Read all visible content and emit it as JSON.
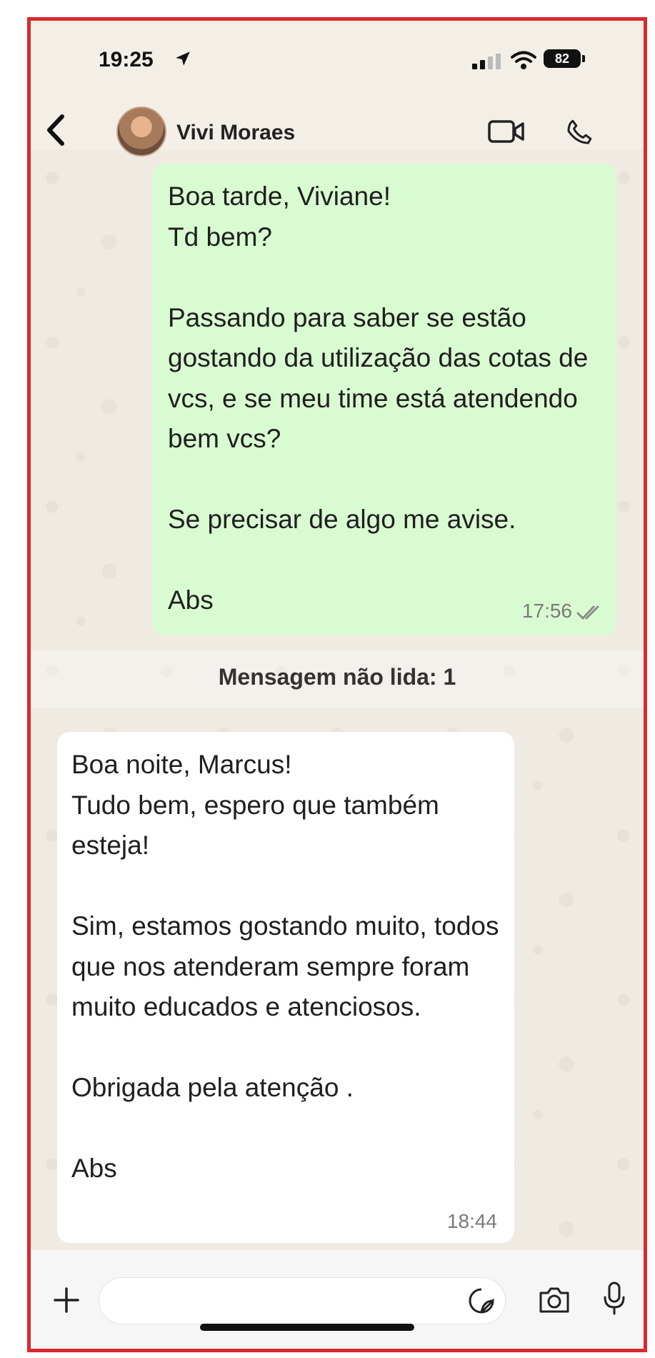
{
  "status_bar": {
    "time": "19:25",
    "battery": "82"
  },
  "header": {
    "contact_name": "Vivi Moraes"
  },
  "messages": [
    {
      "direction": "outgoing",
      "text": "Boa tarde, Viviane!\nTd bem?\n\nPassando para saber se estão gostando da utilização das cotas de vcs, e se meu time está atendendo bem vcs?\n\nSe precisar de algo me avise.\n\nAbs",
      "time": "17:56"
    },
    {
      "direction": "incoming",
      "text": "Boa noite, Marcus!\nTudo bem, espero que também esteja!\n\nSim, estamos gostando muito, todos que nos atenderam sempre foram muito educados e atenciosos.\n\nObrigada pela atenção .\n\nAbs",
      "time": "18:44"
    }
  ],
  "unread_separator": "Mensagem não lida: 1",
  "colors": {
    "outgoing_bubble": "#d9fbd1",
    "incoming_bubble": "#ffffff",
    "frame_border": "#d9292e"
  }
}
